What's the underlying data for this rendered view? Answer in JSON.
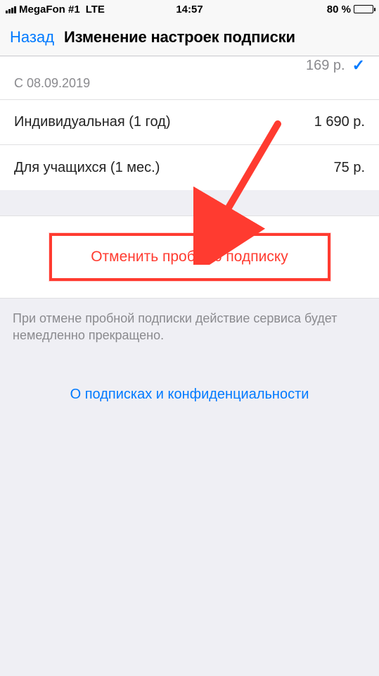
{
  "status": {
    "carrier": "MegaFon #1",
    "network": "LTE",
    "time": "14:57",
    "battery_pct": "80 %"
  },
  "nav": {
    "back": "Назад",
    "title": "Изменение настроек подписки"
  },
  "selected_option": {
    "price": "169 р.",
    "from": "С 08.09.2019"
  },
  "options": [
    {
      "label": "Индивидуальная (1 год)",
      "price": "1 690 р."
    },
    {
      "label": "Для учащихся (1 мес.)",
      "price": "75 р."
    }
  ],
  "cancel": {
    "button": "Отменить пробную подписку",
    "note": "При отмене пробной подписки действие сервиса будет немедленно прекращено."
  },
  "privacy_link": "О подписках и конфиденциальности"
}
